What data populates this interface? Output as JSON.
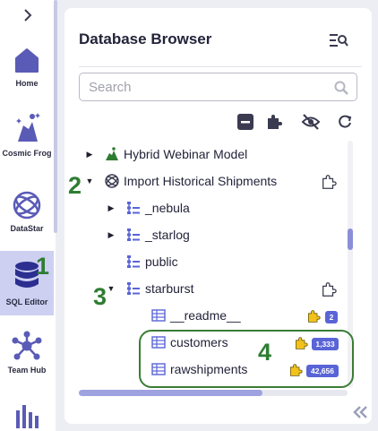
{
  "nav": {
    "items": [
      {
        "label": "Home",
        "icon": "home-icon"
      },
      {
        "label": "Cosmic Frog",
        "icon": "cosmic-frog-icon"
      },
      {
        "label": "DataStar",
        "icon": "datastar-icon"
      },
      {
        "label": "SQL Editor",
        "icon": "database-icon",
        "active": true
      },
      {
        "label": "Team Hub",
        "icon": "team-hub-icon"
      },
      {
        "label": "",
        "icon": "bar-chart-icon"
      }
    ]
  },
  "panel": {
    "title": "Database Browser",
    "search_placeholder": "Search"
  },
  "tree": [
    {
      "label": "Hybrid Webinar Model",
      "icon": "frog-model-icon",
      "expanded": false
    },
    {
      "label": "Import Historical Shipments",
      "icon": "datastar-project-icon",
      "expanded": true
    },
    {
      "label": "_nebula",
      "icon": "schema-icon",
      "expanded": false
    },
    {
      "label": "_starlog",
      "icon": "schema-icon",
      "expanded": false
    },
    {
      "label": "public",
      "icon": "schema-icon"
    },
    {
      "label": "starburst",
      "icon": "schema-icon",
      "expanded": true
    },
    {
      "label": "__readme__",
      "icon": "table-icon",
      "badge": "2"
    },
    {
      "label": "customers",
      "icon": "table-icon",
      "badge": "1,333"
    },
    {
      "label": "rawshipments",
      "icon": "table-icon",
      "badge": "42,656"
    }
  ],
  "annotations": [
    "1",
    "2",
    "3",
    "4"
  ],
  "colors": {
    "accent": "#5964d6",
    "annotation": "#2e7d32",
    "active_nav_bg": "#cdd0f1",
    "puzzle_yellow": "#f2c21b"
  }
}
